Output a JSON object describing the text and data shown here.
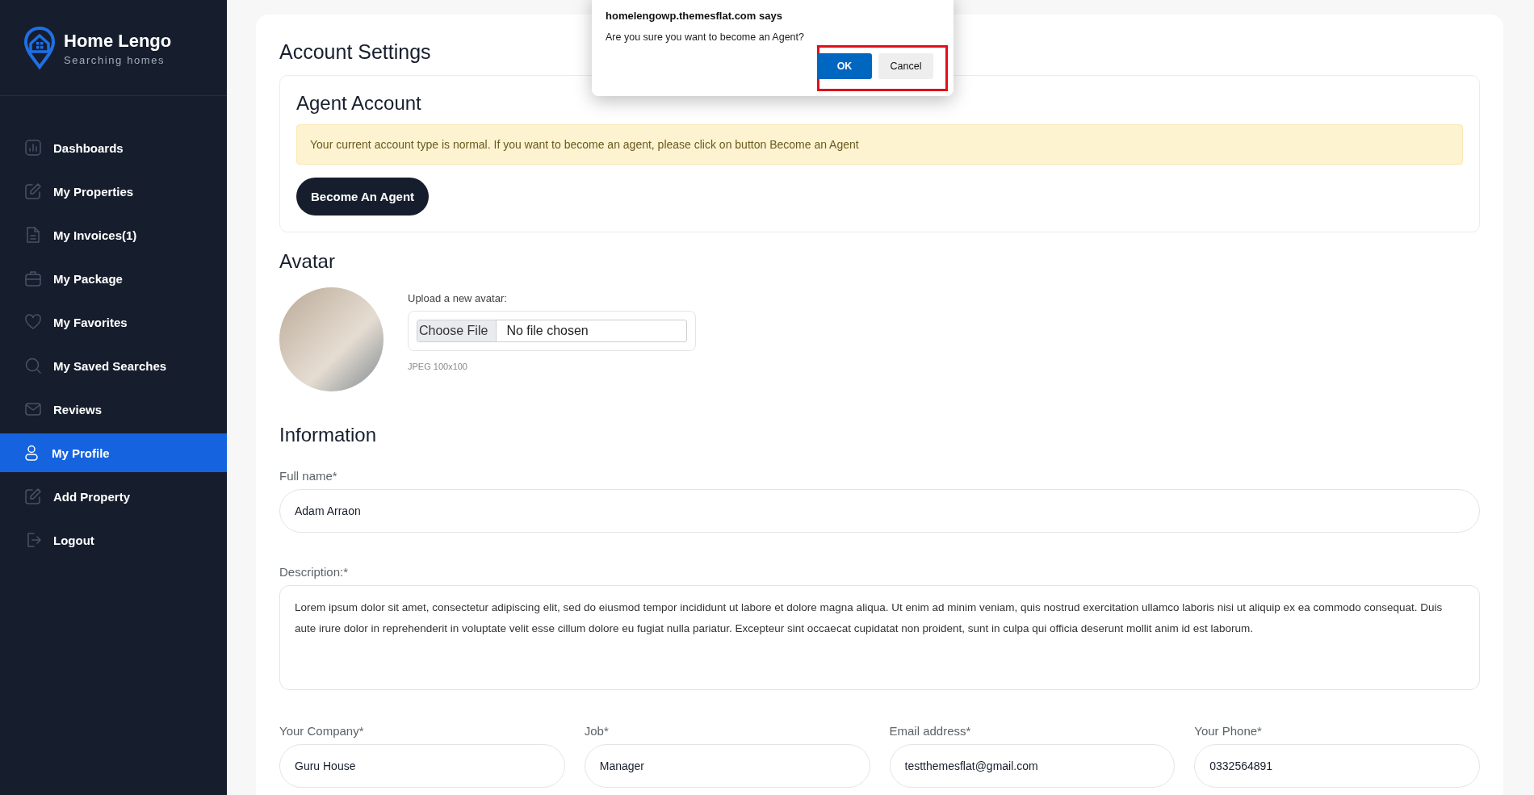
{
  "brand": {
    "title": "Home Lengo",
    "tagline": "Searching homes"
  },
  "sidebar": {
    "items": [
      {
        "label": "Dashboards",
        "selected": false
      },
      {
        "label": "My Properties",
        "selected": false
      },
      {
        "label": "My Invoices(1)",
        "selected": false
      },
      {
        "label": "My Package",
        "selected": false
      },
      {
        "label": "My Favorites",
        "selected": false
      },
      {
        "label": "My Saved Searches",
        "selected": false
      },
      {
        "label": "Reviews",
        "selected": false
      },
      {
        "label": "My Profile",
        "selected": true
      },
      {
        "label": "Add Property",
        "selected": false
      },
      {
        "label": "Logout",
        "selected": false
      }
    ]
  },
  "page_title": "Account Settings",
  "agent_account": {
    "title": "Agent Account",
    "notice": "Your current account type is normal. If you want to become an agent, please click on button Become an Agent",
    "button": "Become An Agent"
  },
  "avatar": {
    "title": "Avatar",
    "upload_label": "Upload a new avatar:",
    "choose_button": "Choose File",
    "file_status": "No file chosen",
    "hint": "JPEG 100x100"
  },
  "information": {
    "title": "Information",
    "full_name": {
      "label": "Full name*",
      "value": "Adam Arraon"
    },
    "description": {
      "label": "Description:*",
      "value": "Lorem ipsum dolor sit amet, consectetur adipiscing elit, sed do eiusmod tempor incididunt ut labore et dolore magna aliqua. Ut enim ad minim veniam, quis nostrud exercitation ullamco laboris nisi ut aliquip ex ea commodo consequat. Duis aute irure dolor in reprehenderit in voluptate velit esse cillum dolore eu fugiat nulla pariatur. Excepteur sint occaecat cupidatat non proident, sunt in culpa qui officia deserunt mollit anim id est laborum."
    },
    "fields": [
      {
        "label": "Your Company*",
        "value": "Guru House"
      },
      {
        "label": "Job*",
        "value": "Manager"
      },
      {
        "label": "Email address*",
        "value": "testthemesflat@gmail.com"
      },
      {
        "label": "Your Phone*",
        "value": "0332564891"
      }
    ]
  },
  "dialog": {
    "title": "homelengowp.themesflat.com says",
    "message": "Are you sure you want to become an Agent?",
    "buttons": [
      {
        "label": "OK",
        "kind": "primary"
      },
      {
        "label": "Cancel",
        "kind": "secondary"
      }
    ]
  }
}
